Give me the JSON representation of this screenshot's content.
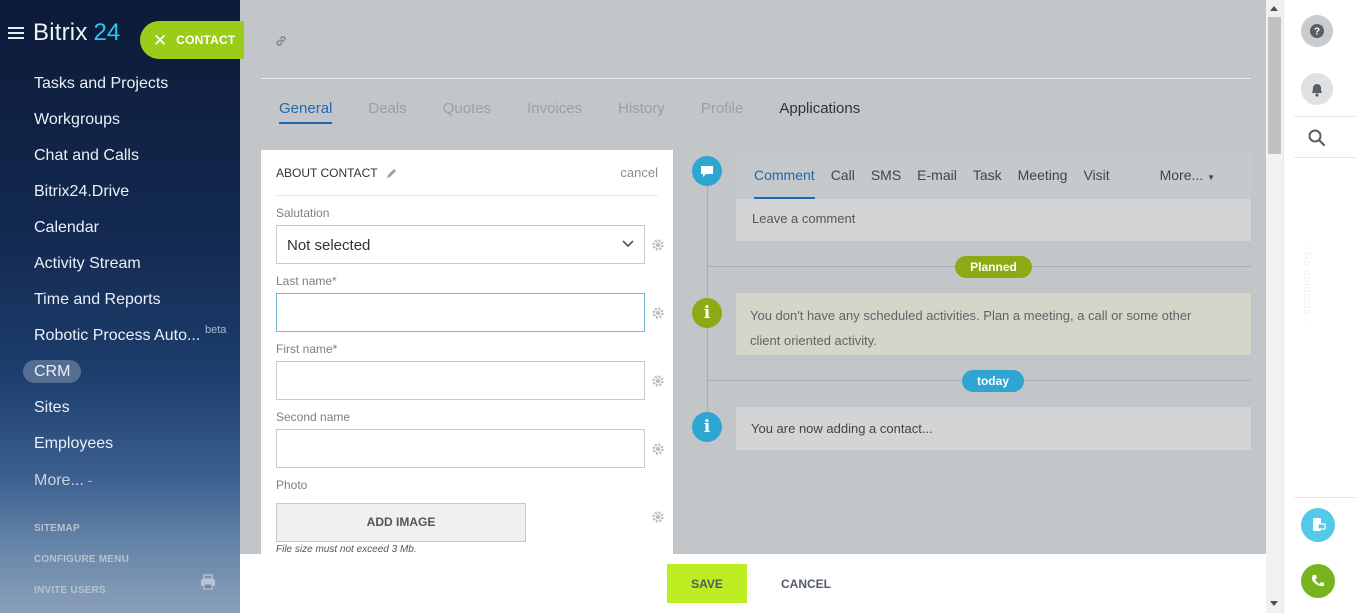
{
  "sidebar": {
    "brand_name": "Bitrix",
    "brand_num": "24",
    "items": [
      {
        "label": "Tasks and Projects"
      },
      {
        "label": "Workgroups"
      },
      {
        "label": "Chat and Calls"
      },
      {
        "label": "Bitrix24.Drive"
      },
      {
        "label": "Calendar"
      },
      {
        "label": "Activity Stream"
      },
      {
        "label": "Time and Reports"
      },
      {
        "label": "Robotic Process Auto...",
        "badge": "beta"
      },
      {
        "label": "CRM"
      },
      {
        "label": "Sites"
      },
      {
        "label": "Employees"
      },
      {
        "label": "More...",
        "suffix": "-"
      }
    ],
    "bottom_links": [
      "SITEMAP",
      "CONFIGURE MENU",
      "INVITE USERS"
    ]
  },
  "slider": {
    "close_label": "CONTACT",
    "close_icon": "✕"
  },
  "tabs": [
    "General",
    "Deals",
    "Quotes",
    "Invoices",
    "History",
    "Profile",
    "Applications"
  ],
  "form": {
    "title": "ABOUT CONTACT",
    "cancel": "cancel",
    "salutation_label": "Salutation",
    "salutation_value": "Not selected",
    "last_name_label": "Last name*",
    "first_name_label": "First name*",
    "second_name_label": "Second name",
    "photo_label": "Photo",
    "add_image": "ADD IMAGE",
    "file_note": "File size must not exceed 3 Mb."
  },
  "composer": {
    "tabs": [
      "Comment",
      "Call",
      "SMS",
      "E-mail",
      "Task",
      "Meeting",
      "Visit"
    ],
    "more": "More...",
    "placeholder": "Leave a comment"
  },
  "timeline": {
    "planned_badge": "Planned",
    "planned_text": "You don't have any scheduled activities. Plan a meeting, a call or some other client oriented activity.",
    "today_badge": "today",
    "today_text": "You are now adding a contact..."
  },
  "footer": {
    "save": "SAVE",
    "cancel": "CANCEL"
  },
  "right_panel": {
    "no_contacts": "- No contacts -"
  },
  "colors": {
    "accent_green": "#9acc1a",
    "save_green": "#bbed21",
    "link_blue": "#2067b0",
    "timeline_blue": "#2fa6d2",
    "timeline_olive": "#8aab14"
  }
}
